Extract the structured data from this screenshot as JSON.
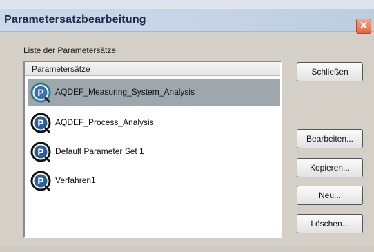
{
  "window": {
    "title": "Parametersatzbearbeitung",
    "close_glyph": "✕"
  },
  "group": {
    "label": "Liste der Parametersätze"
  },
  "list": {
    "header": "Parametersätze",
    "selected_index": 0,
    "items": [
      {
        "label": "AQDEF_Measuring_System_Analysis",
        "icon": "p-parameter-icon"
      },
      {
        "label": "AQDEF_Process_Analysis",
        "icon": "p-parameter-icon"
      },
      {
        "label": "Default Parameter Set 1",
        "icon": "p-parameter-icon"
      },
      {
        "label": "Verfahren1",
        "icon": "p-parameter-icon"
      }
    ]
  },
  "buttons": {
    "close": "Schließen",
    "edit": "Bearbeiten...",
    "copy": "Kopieren...",
    "new": "Neu...",
    "delete": "Löschen..."
  },
  "colors": {
    "selection": "#9ea6ae",
    "icon_ring": "#2b5e9e",
    "icon_selected_ring": "#3f8fa0"
  }
}
